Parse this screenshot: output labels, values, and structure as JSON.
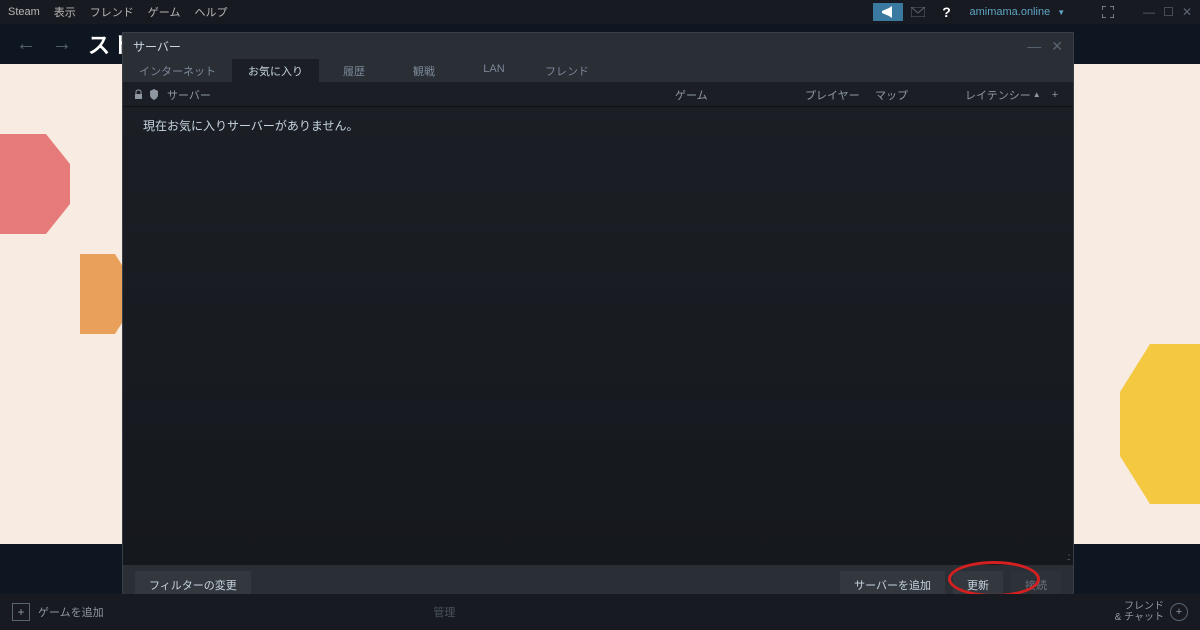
{
  "topbar": {
    "brand": "Steam",
    "menu": [
      "表示",
      "フレンド",
      "ゲーム",
      "ヘルプ"
    ],
    "username": "amimama.online"
  },
  "nav": {
    "store": "スト"
  },
  "dialog": {
    "title": "サーバー",
    "tabs": [
      "インターネット",
      "お気に入り",
      "履歴",
      "観戦",
      "LAN",
      "フレンド"
    ],
    "columns": {
      "server": "サーバー",
      "game": "ゲーム",
      "player": "プレイヤー",
      "map": "マップ",
      "latency": "レイテンシー"
    },
    "empty_message": "現在お気に入りサーバーがありません。",
    "footer": {
      "filter_change": "フィルターの変更",
      "add_server": "サーバーを追加",
      "refresh": "更新",
      "connect": "接続"
    }
  },
  "bottombar": {
    "add_game": "ゲームを追加",
    "manage": "管理",
    "friends_line1": "フレンド",
    "friends_line2": "& チャット"
  }
}
